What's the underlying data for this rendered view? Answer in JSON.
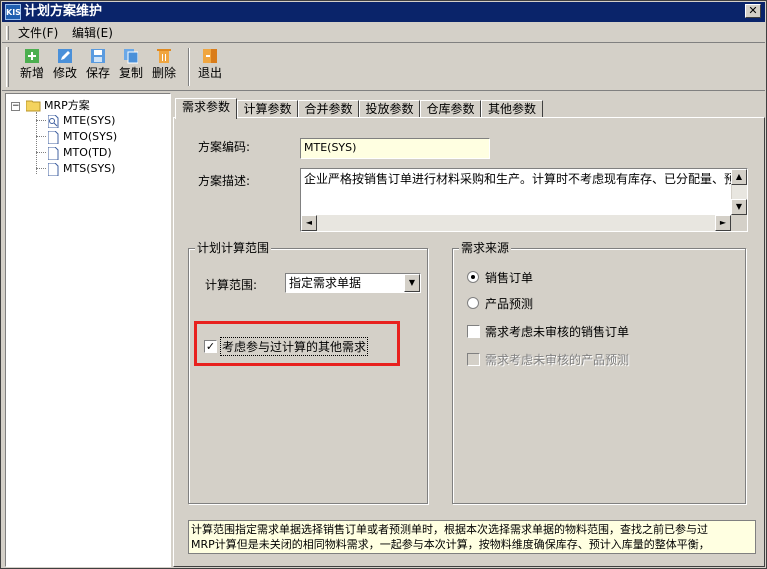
{
  "window": {
    "title": "计划方案维护",
    "app_icon_text": "KIS",
    "close_symbol": "✕"
  },
  "menu": [
    {
      "label": "文件(F)"
    },
    {
      "label": "编辑(E)"
    }
  ],
  "toolbar": {
    "buttons": [
      {
        "label": "新增",
        "icon": "add-icon"
      },
      {
        "label": "修改",
        "icon": "edit-icon"
      },
      {
        "label": "保存",
        "icon": "save-icon"
      },
      {
        "label": "复制",
        "icon": "copy-icon"
      },
      {
        "label": "删除",
        "icon": "delete-icon"
      },
      {
        "label": "退出",
        "icon": "exit-icon"
      }
    ]
  },
  "tree": {
    "expand_symbol": "−",
    "root": "MRP方案",
    "items": [
      "MTE(SYS)",
      "MTO(SYS)",
      "MTO(TD)",
      "MTS(SYS)"
    ]
  },
  "tabs": [
    {
      "label": "需求参数",
      "active": true
    },
    {
      "label": "计算参数"
    },
    {
      "label": "合并参数"
    },
    {
      "label": "投放参数"
    },
    {
      "label": "仓库参数"
    },
    {
      "label": "其他参数"
    }
  ],
  "form": {
    "code_label": "方案编码:",
    "code_value": "MTE(SYS)",
    "desc_label": "方案描述:",
    "desc_value": "企业严格按销售订单进行材料采购和生产。计算时不考虑现有库存、已分配量、预"
  },
  "calc_range": {
    "title": "计划计算范围",
    "range_label": "计算范围:",
    "range_value": "指定需求单据",
    "include_other_label": "考虑参与过计算的其他需求",
    "include_other_checked": true
  },
  "demand_source": {
    "title": "需求来源",
    "options": [
      {
        "label": "销售订单",
        "selected": true
      },
      {
        "label": "产品预测",
        "selected": false
      }
    ],
    "unaudited_sales_label": "需求考虑未审核的销售订单",
    "unaudited_sales_checked": false,
    "unaudited_forecast_label": "需求考虑未审核的产品预测",
    "unaudited_forecast_enabled": false
  },
  "hint": {
    "line1": "计算范围指定需求单据选择销售订单或者预测单时，根据本次选择需求单据的物料范围，查找之前已参与过",
    "line2": "MRP计算但是未关闭的相同物料需求，一起参与本次计算，按物料维度确保库存、预计入库量的整体平衡，"
  },
  "colors": {
    "titlebar": "#0a246a",
    "highlight_box": "#e8211e",
    "field_background": "#ffffe1"
  }
}
